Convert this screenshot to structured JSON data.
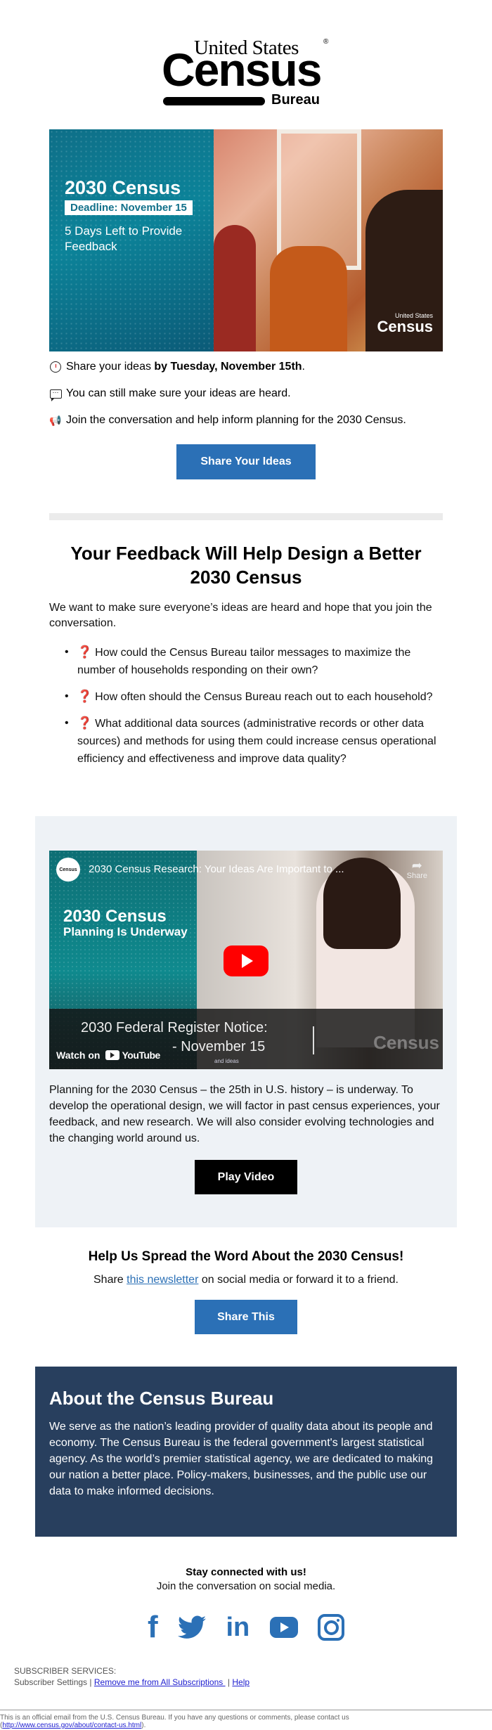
{
  "logo": {
    "line1": "United States",
    "registered": "®",
    "line2": "Census",
    "line3": "Bureau"
  },
  "hero": {
    "title": "2030 Census",
    "deadline": "Deadline: November 15",
    "subtitle": "5 Days Left to Provide Feedback",
    "watermark_top": "United States",
    "watermark_main": "Census"
  },
  "highlights": [
    {
      "icon": "clock-icon",
      "text_before": "Share your ideas ",
      "text_bold": "by Tuesday, November 15th",
      "text_after": "."
    },
    {
      "icon": "speech-bubble-icon",
      "text": "You can still make sure your ideas are heard."
    },
    {
      "icon": "megaphone-icon",
      "text": "Join the conversation and help inform planning for the 2030 Census."
    }
  ],
  "share_ideas_button": "Share Your Ideas",
  "feedback": {
    "heading": "Your Feedback Will Help Design a Better 2030 Census",
    "intro": "We want to make sure everyone’s ideas are heard and hope that you join the conversation.",
    "questions": [
      "How could the Census Bureau tailor messages to maximize the number of households responding on their own?",
      "How often should the Census Bureau reach out to each household?",
      "What additional data sources (administrative records or other data sources) and methods for using them could increase census operational efficiency and effectiveness and improve data quality?"
    ],
    "question_icon": "❓"
  },
  "video": {
    "channel_label": "Census",
    "title": "2030 Census Research: Your Ideas Are Important to ...",
    "share_label": "Share",
    "thumb_title": "2030 Census",
    "thumb_subtitle": "Planning Is Underway",
    "notice_line1": "2030 Federal Register Notice:",
    "notice_line2": "- November 15",
    "notice_small": "and ideas",
    "watermark": "Census",
    "watch_on": "Watch on",
    "youtube": "YouTube",
    "description": "Planning for the 2030 Census – the 25th in U.S. history – is underway. To develop the operational design, we will factor in past census experiences, your feedback, and new research. We will also consider evolving technologies and the changing world around us.",
    "play_button": "Play Video"
  },
  "spread": {
    "heading": "Help Us Spread the Word About the 2030 Census!",
    "text_before": "Share ",
    "link_text": "this newsletter",
    "text_after": " on social media or forward it to a friend.",
    "button": "Share This"
  },
  "about": {
    "heading": "About the Census Bureau",
    "body": "We serve as the nation’s leading provider of quality data about its people and economy. The Census Bureau is the federal government's largest statistical agency. As the world’s premier statistical agency, we are dedicated to making our nation a better place. Policy-makers, businesses, and the public use our data to make informed decisions."
  },
  "social": {
    "heading": "Stay connected with us!",
    "subheading": "Join the conversation on social media.",
    "networks": [
      "facebook",
      "twitter",
      "linkedin",
      "youtube",
      "instagram"
    ]
  },
  "subscriber": {
    "heading": "SUBSCRIBER SERVICES:",
    "settings": "Subscriber Settings",
    "separator": " | ",
    "remove": "Remove me from All Subscriptions ",
    "help": "Help"
  },
  "footer": {
    "text": "This is an official email from the U.S. Census Bureau. If you have any questions or comments, please contact us (",
    "link": "http://www.census.gov/about/contact-us.html",
    "end": ")."
  },
  "colors": {
    "accent_blue": "#2b70b6",
    "about_bg": "#283f5e",
    "video_section_bg": "#eef2f6",
    "divider": "#ebebeb"
  }
}
